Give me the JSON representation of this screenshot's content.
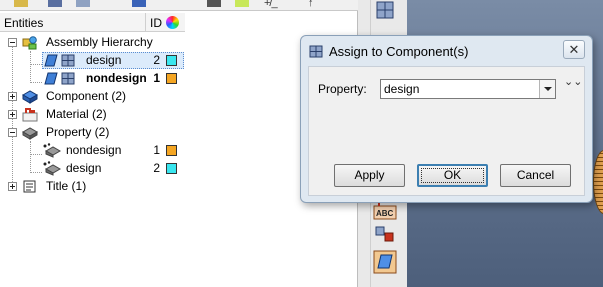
{
  "tree": {
    "header": {
      "entities": "Entities",
      "id": "ID"
    },
    "rows": [
      {
        "label": "Assembly Hierarchy"
      },
      {
        "label": "design",
        "id": "2",
        "color": "#39e6ef"
      },
      {
        "label": "nondesign",
        "id": "1",
        "color": "#f5a623"
      },
      {
        "label": "Component (2)"
      },
      {
        "label": "Material (2)"
      },
      {
        "label": "Property (2)"
      },
      {
        "label": "nondesign",
        "id": "1",
        "color": "#f5a623"
      },
      {
        "label": "design",
        "id": "2",
        "color": "#39e6ef"
      },
      {
        "label": "Title (1)"
      }
    ]
  },
  "toolbar": {
    "plus_minus": "+/_",
    "arrow_up": "↑"
  },
  "right_toolbar": {
    "abc_label": "ABC"
  },
  "dialog": {
    "title": "Assign to Component(s)",
    "close_symbol": "✕",
    "property_label": "Property:",
    "property_value": "design",
    "expand_symbol": "⌄⌄",
    "buttons": {
      "apply": "Apply",
      "ok": "OK",
      "cancel": "Cancel"
    }
  },
  "colors": {
    "cyan_swatch": "#39e6ef",
    "orange_swatch": "#f5a623",
    "selection": "#dcebfb",
    "dialog_frame": "#dfe8f1"
  },
  "icons": [
    "folder-icon",
    "assembly-icon",
    "component-icon",
    "material-icon",
    "property-icon",
    "title-icon",
    "grid-icon",
    "dropdown-arrow-icon",
    "chevron-down-icon"
  ]
}
